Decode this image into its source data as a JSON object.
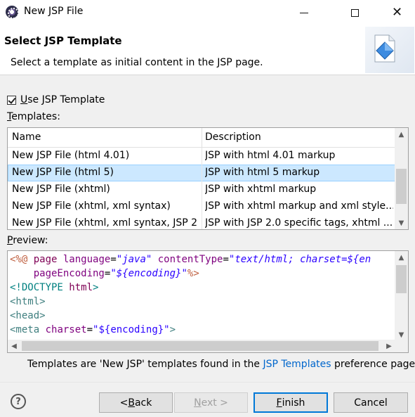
{
  "window": {
    "title": "New JSP File",
    "controls": {
      "minimize": "—",
      "maximize": "☐",
      "close": "✕"
    }
  },
  "banner": {
    "title": "Select JSP Template",
    "description": "Select a template as initial content in the JSP page."
  },
  "use_template": {
    "checked": true,
    "label_prefix": "",
    "label_mnemonic": "U",
    "label_rest": "se JSP Template"
  },
  "templates_label": {
    "mnemonic": "T",
    "rest": "emplates:"
  },
  "table": {
    "columns": [
      "Name",
      "Description"
    ],
    "rows": [
      {
        "name": "New JSP File (html 4.01)",
        "description": "JSP with html 4.01 markup",
        "selected": false
      },
      {
        "name": "New JSP File (html 5)",
        "description": "JSP with html 5 markup",
        "selected": true
      },
      {
        "name": "New JSP File (xhtml)",
        "description": "JSP with xhtml markup",
        "selected": false
      },
      {
        "name": "New JSP File (xhtml, xml syntax)",
        "description": "JSP with xhtml markup and xml style...",
        "selected": false
      },
      {
        "name": "New JSP File (xhtml, xml syntax, JSP 2...",
        "description": "JSP with JSP 2.0 specific tags, xhtml ...",
        "selected": false
      }
    ]
  },
  "preview_label": {
    "mnemonic": "P",
    "rest": "review:"
  },
  "preview": {
    "line1": {
      "open": "<%@",
      "directive": " page ",
      "a1": "language",
      "eq1": "=",
      "v1": "\"java\"",
      "a2": " contentType",
      "eq2": "=",
      "v2": "\"text/html; charset=${en"
    },
    "line2": {
      "indent": "    ",
      "a1": "pageEncoding",
      "eq1": "=",
      "v1": "\"${encoding}\"",
      "close": "%>"
    },
    "line3": {
      "open": "<!DOCTYPE",
      "name": " html",
      "close": ">"
    },
    "line4": {
      "text": "<html>"
    },
    "line5": {
      "text": "<head>"
    },
    "line6": {
      "open": "<meta",
      "attr": " charset",
      "eq": "=",
      "val": "\"${encoding}\"",
      "close": ">"
    }
  },
  "note": {
    "before": "Templates are 'New JSP' templates found in the ",
    "link": "JSP Templates",
    "after": " preference page."
  },
  "buttons": {
    "help": "?",
    "back": {
      "prefix": "< ",
      "mnemonic": "B",
      "rest": "ack"
    },
    "next": {
      "mnemonic": "N",
      "rest": "ext >"
    },
    "finish": {
      "mnemonic": "F",
      "rest": "inish"
    },
    "cancel": "Cancel"
  },
  "scroll_arrows": {
    "up": "▲",
    "down": "▼",
    "left": "◀",
    "right": "▶"
  }
}
